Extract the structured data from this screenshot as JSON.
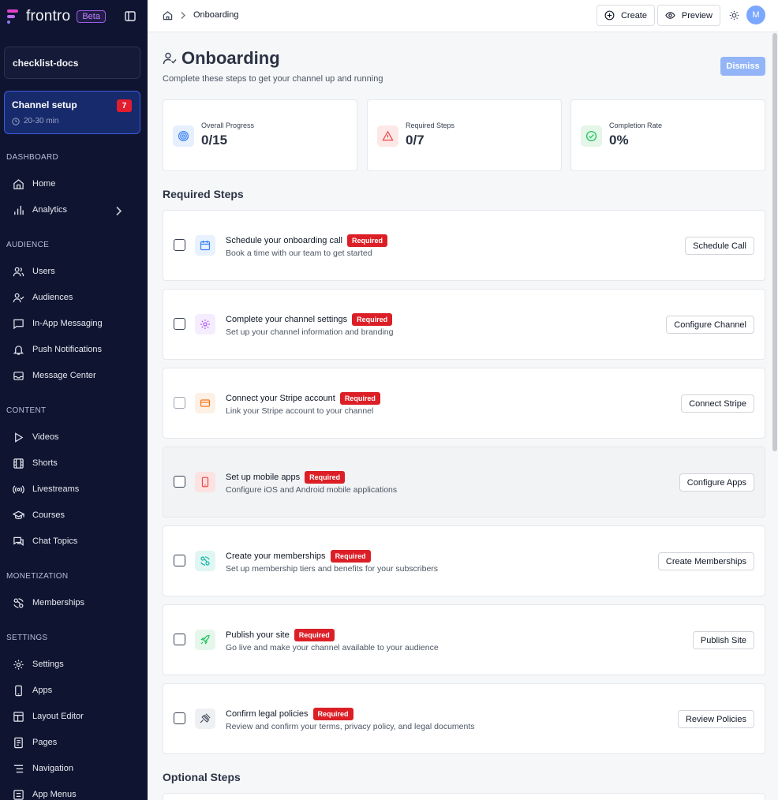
{
  "brand": {
    "name": "frontro",
    "badge": "Beta"
  },
  "workspace": {
    "name": "checklist-docs"
  },
  "setup_card": {
    "title": "Channel setup",
    "count": "7",
    "time": "20-30 min"
  },
  "sidebar": {
    "sections": [
      {
        "label": "DASHBOARD"
      },
      {
        "label": "AUDIENCE"
      },
      {
        "label": "CONTENT"
      },
      {
        "label": "MONETIZATION"
      },
      {
        "label": "SETTINGS"
      }
    ],
    "items": [
      {
        "label": "Home",
        "icon": "home-icon"
      },
      {
        "label": "Analytics",
        "icon": "bar-chart-icon"
      },
      {
        "label": "Users",
        "icon": "users-icon"
      },
      {
        "label": "Audiences",
        "icon": "user-check-icon"
      },
      {
        "label": "In-App Messaging",
        "icon": "message-square-icon"
      },
      {
        "label": "Push Notifications",
        "icon": "bell-icon"
      },
      {
        "label": "Message Center",
        "icon": "inbox-icon"
      },
      {
        "label": "Videos",
        "icon": "play-icon"
      },
      {
        "label": "Shorts",
        "icon": "film-icon"
      },
      {
        "label": "Livestreams",
        "icon": "broadcast-icon"
      },
      {
        "label": "Courses",
        "icon": "graduation-cap-icon"
      },
      {
        "label": "Chat Topics",
        "icon": "chat-icon"
      },
      {
        "label": "Memberships",
        "icon": "membership-icon"
      },
      {
        "label": "Settings",
        "icon": "gear-icon"
      },
      {
        "label": "Apps",
        "icon": "smartphone-icon"
      },
      {
        "label": "Layout Editor",
        "icon": "layout-icon"
      },
      {
        "label": "Pages",
        "icon": "file-icon"
      },
      {
        "label": "Navigation",
        "icon": "list-icon"
      },
      {
        "label": "App Menus",
        "icon": "menu-icon"
      }
    ]
  },
  "topbar": {
    "breadcrumb": "Onboarding",
    "create_label": "Create",
    "preview_label": "Preview",
    "avatar_initial": "M"
  },
  "page": {
    "title": "Onboarding",
    "subtitle": "Complete these steps to get your channel up and running",
    "dismiss_label": "Dismiss"
  },
  "stats": [
    {
      "label": "Overall Progress",
      "value": "0/15",
      "icon": "target-icon"
    },
    {
      "label": "Required Steps",
      "value": "0/7",
      "icon": "alert-triangle-icon"
    },
    {
      "label": "Completion Rate",
      "value": "0%",
      "icon": "check-circle-icon"
    }
  ],
  "required_title": "Required Steps",
  "required_badge": "Required",
  "steps": [
    {
      "title": "Schedule your onboarding call",
      "desc": "Book a time with our team to get started",
      "button": "Schedule Call",
      "icon": "calendar-icon",
      "color": "#3b82f6",
      "bg": "#e8f1fe"
    },
    {
      "title": "Complete your channel settings",
      "desc": "Set up your channel information and branding",
      "button": "Configure Channel",
      "icon": "gear-icon",
      "color": "#a855f7",
      "bg": "#f5ecfd"
    },
    {
      "title": "Connect your Stripe account",
      "desc": "Link your Stripe account to your channel",
      "button": "Connect Stripe",
      "icon": "credit-card-icon",
      "color": "#f97316",
      "bg": "#fdf0e4"
    },
    {
      "title": "Set up mobile apps",
      "desc": "Configure iOS and Android mobile applications",
      "button": "Configure Apps",
      "icon": "smartphone-icon",
      "color": "#ef4444",
      "bg": "#fde6e6"
    },
    {
      "title": "Create your memberships",
      "desc": "Set up membership tiers and benefits for your subscribers",
      "button": "Create Memberships",
      "icon": "membership-icon",
      "color": "#14b8a6",
      "bg": "#e0f6f2"
    },
    {
      "title": "Publish your site",
      "desc": "Go live and make your channel available to your audience",
      "button": "Publish Site",
      "icon": "rocket-icon",
      "color": "#22c55e",
      "bg": "#e5f7ea"
    },
    {
      "title": "Confirm legal policies",
      "desc": "Review and confirm your terms, privacy policy, and legal documents",
      "button": "Review Policies",
      "icon": "gavel-icon",
      "color": "#6b7280",
      "bg": "#eef0f3"
    }
  ],
  "optional_title": "Optional Steps"
}
